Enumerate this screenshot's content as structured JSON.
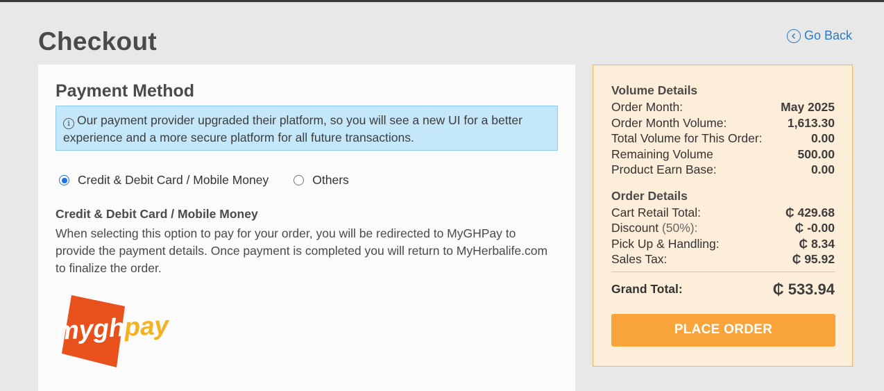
{
  "header": {
    "title": "Checkout",
    "go_back_label": "Go Back"
  },
  "payment": {
    "title": "Payment Method",
    "info_text": "Our payment provider upgraded their platform, so you will see a new UI for a better experience and a more secure platform for all future transactions.",
    "options": [
      {
        "label": "Credit & Debit Card / Mobile Money",
        "selected": true
      },
      {
        "label": "Others",
        "selected": false
      }
    ],
    "selected_option_title": "Credit & Debit Card / Mobile Money",
    "selected_option_desc": "When selecting this option to pay for your order, you will be redirected to MyGHPay to provide the payment details. Once payment is completed you will return to MyHerbalife.com to finalize the order.",
    "logo": {
      "text_a": "mygh",
      "text_b": "pay",
      "colors": {
        "square": "#e8511c",
        "text_a": "#ffffff",
        "text_b": "#f5b21e"
      }
    }
  },
  "summary": {
    "volume_title": "Volume Details",
    "volume_rows": [
      {
        "label": "Order Month:",
        "value": "May 2025"
      },
      {
        "label": "Order Month Volume:",
        "value": "1,613.30"
      },
      {
        "label": "Total Volume for This Order:",
        "value": "0.00"
      },
      {
        "label": "Remaining Volume",
        "value": "500.00"
      },
      {
        "label": "Product Earn Base:",
        "value": "0.00"
      }
    ],
    "order_title": "Order Details",
    "order_rows": [
      {
        "label": "Cart Retail Total:",
        "note": "",
        "value": "₵  429.68"
      },
      {
        "label": "Discount ",
        "note": "(50%):",
        "value": "₵  -0.00"
      },
      {
        "label": "Pick Up & Handling:",
        "note": "",
        "value": "₵  8.34"
      },
      {
        "label": "Sales Tax:",
        "note": "",
        "value": "₵  95.92"
      }
    ],
    "grand_total_label": "Grand Total:",
    "grand_total_value": "₵  533.94",
    "place_order_label": "PLACE ORDER"
  },
  "colors": {
    "accent_blue": "#2a7bc8",
    "info_bg": "#c4e7fa",
    "summary_bg": "#fdeed9",
    "summary_border": "#f6b45a",
    "button": "#f9a43b"
  }
}
